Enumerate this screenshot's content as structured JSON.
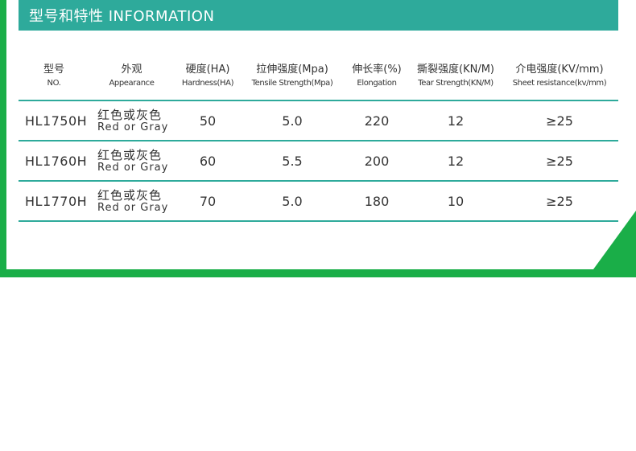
{
  "section_title": "型号和特性 INFORMATION",
  "headers": [
    {
      "zh": "型号",
      "en": "NO."
    },
    {
      "zh": "外观",
      "en": "Appearance"
    },
    {
      "zh": "硬度(HA)",
      "en": "Hardness(HA)"
    },
    {
      "zh": "拉伸强度(Mpa)",
      "en": "Tensile Strength(Mpa)"
    },
    {
      "zh": "伸长率(%)",
      "en": "Elongation"
    },
    {
      "zh": "撕裂强度(KN/M)",
      "en": "Tear Strength(KN/M)"
    },
    {
      "zh": "介电强度(KV/mm)",
      "en": "Sheet resistance(kv/mm)"
    }
  ],
  "rows": [
    {
      "model": "HL1750H",
      "appearance_zh": "红色或灰色",
      "appearance_en": "Red or  Gray",
      "hardness": "50",
      "tensile": "5.0",
      "elongation": "220",
      "tear": "12",
      "dielectric": "≥25"
    },
    {
      "model": "HL1760H",
      "appearance_zh": "红色或灰色",
      "appearance_en": "Red or  Gray",
      "hardness": "60",
      "tensile": "5.5",
      "elongation": "200",
      "tear": "12",
      "dielectric": "≥25"
    },
    {
      "model": "HL1770H",
      "appearance_zh": "红色或灰色",
      "appearance_en": "Red or  Gray",
      "hardness": "70",
      "tensile": "5.0",
      "elongation": "180",
      "tear": "10",
      "dielectric": "≥25"
    }
  ],
  "colors": {
    "accent_teal": "#2eaa9b",
    "frame_green": "#1aae48"
  }
}
